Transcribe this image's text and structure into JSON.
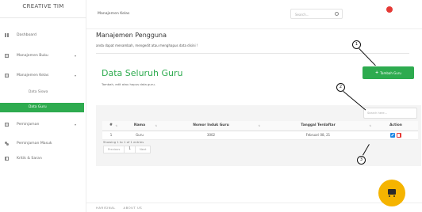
{
  "sidebar": {
    "brand": "CREATIVE TIM",
    "items": [
      {
        "label": "Dashboard",
        "icon": "dashboard-icon"
      },
      {
        "label": "Manajemen Buku",
        "icon": "book-icon",
        "chevron": "▾"
      },
      {
        "label": "Manajemen Kelas",
        "icon": "class-icon",
        "chevron": "▾"
      },
      {
        "label": "Peminjaman",
        "icon": "loan-icon",
        "chevron": "▾"
      },
      {
        "label": "Peminjaman Masuk",
        "icon": "users-icon"
      },
      {
        "label": "Kritik & Saran",
        "icon": "feedback-icon"
      }
    ],
    "sub_items": [
      {
        "label": "Data Siswa"
      },
      {
        "label": "Data Guru",
        "active": true
      }
    ],
    "active_color": "#2eab4f"
  },
  "topbar": {
    "breadcrumb": "Manajemen Kelas",
    "search_placeholder": "Search...",
    "notification_color": "#e53935"
  },
  "page": {
    "title": "Manajemen Pengguna",
    "description": "anda dapat menambah, mengedit atau menghapus data disini !"
  },
  "card": {
    "title": "Data Seluruh Guru",
    "subtitle": "Tambah, edit atau hapus data guru.",
    "add_button": "Tambah Guru",
    "filter_placeholder": "Search here...",
    "accent": "#2eab4f"
  },
  "table": {
    "columns": [
      "#",
      "Nama",
      "Nomor Induk Guru",
      "Tanggal Terdaftar",
      "Action"
    ],
    "rows": [
      {
        "no": "1",
        "nama": "Guru",
        "nig": "3002",
        "tanggal": "Februari 08, 21"
      }
    ],
    "showing": "Showing 1 to 1 of 1 entries",
    "pager": {
      "prev": "Previous",
      "current": "1",
      "next": "Next"
    }
  },
  "callouts": [
    "1",
    "2",
    "3"
  ],
  "footer": {
    "links": [
      "HARISINAL",
      "ABOUT US"
    ]
  },
  "fab": {
    "icon": "cart-icon",
    "color": "#f5b400"
  }
}
